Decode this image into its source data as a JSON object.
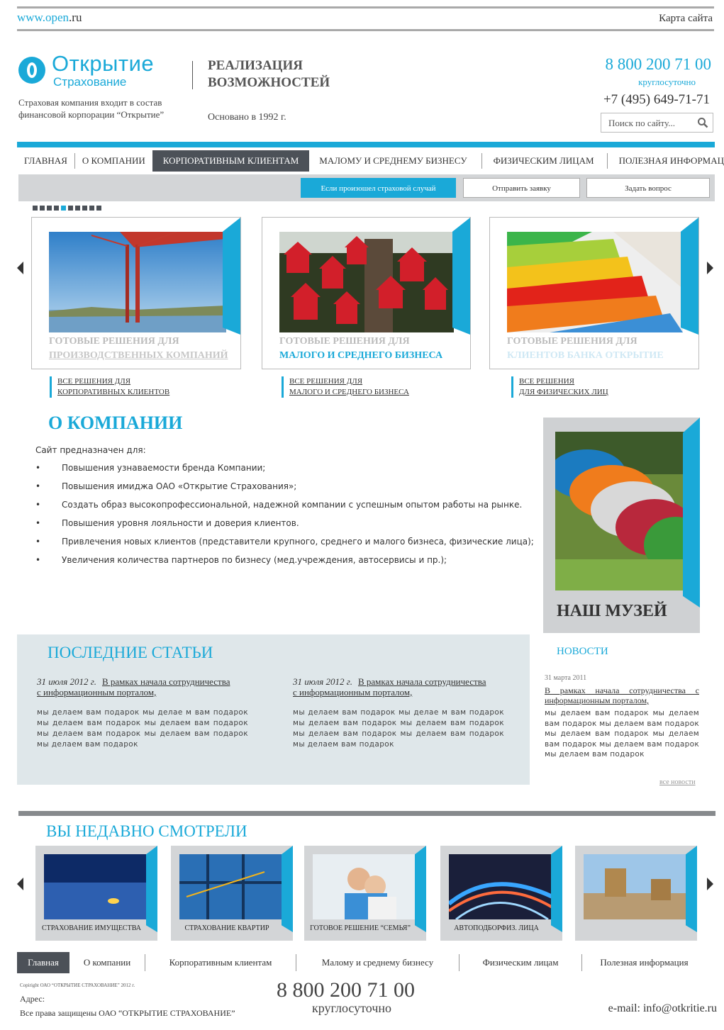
{
  "header": {
    "site_url_prefix": "www.open",
    "site_url_suffix": ".ru",
    "sitemap_label": "Карта сайта",
    "logo_title": "Открытие",
    "logo_subtitle": "Страхование",
    "company_desc": "Страховая компания входит в состав финансовой корпорации “Открытие”",
    "slogan_line1": "РЕАЛИЗАЦИЯ",
    "slogan_line2": "ВОЗМОЖНОСТЕЙ",
    "founded": "Основано в 1992 г.",
    "phone_main": "8 800 200 71 00",
    "phone_main_note": "круглосуточно",
    "phone_moscow": "+7 (495) 649-71-71",
    "search_placeholder": "Поиск по сайту...",
    "search_icon": "magnifier-icon"
  },
  "nav": {
    "items": [
      "ГЛАВНАЯ",
      "О КОМПАНИИ",
      "КОРПОРАТИВНЫМ КЛИЕНТАМ",
      "МАЛОМУ И СРЕДНЕМУ БИЗНЕСУ",
      "ФИЗИЧЕСКИМ ЛИЦАМ",
      "ПОЛЕЗНАЯ ИНФОРМАЦИЯ"
    ],
    "active": "КОРПОРАТИВНЫМ КЛИЕНТАМ"
  },
  "actions": {
    "insured_event": "Если произошел страховой случай",
    "send_request": "Отправить заявку",
    "ask_question": "Задать вопрос"
  },
  "slider": {
    "dot_count": 10,
    "active_dot": 5,
    "cards": [
      {
        "title_line1": "ГОТОВЫЕ РЕШЕНИЯ ДЛЯ",
        "title_line2": "ПРОИЗВОДСТВЕННЫХ КОМПАНИЙ",
        "link_line1": "ВСЕ РЕШЕНИЯ ДЛЯ",
        "link_line2": "КОРПОРАТИВНЫХ КЛИЕНТОВ",
        "image": "bridge"
      },
      {
        "title_line1": "ГОТОВЫЕ РЕШЕНИЯ ДЛЯ",
        "title_line2": "МАЛОГО И СРЕДНЕГО БИЗНЕСА",
        "link_line1": "ВСЕ РЕШЕНИЯ ДЛЯ",
        "link_line2": "МАЛОГО И СРЕДНЕГО БИЗНЕСА",
        "image": "birdhouses"
      },
      {
        "title_line1": "ГОТОВЫЕ РЕШЕНИЯ ДЛЯ",
        "title_line2": "КЛИЕНТОВ БАНКА ОТКРЫТИЕ",
        "link_line1": "ВСЕ РЕШЕНИЯ",
        "link_line2": "ДЛЯ ФИЗИЧЕСКИХ ЛИЦ",
        "image": "colored-stairs"
      }
    ]
  },
  "about": {
    "title": "О КОМПАНИИ",
    "intro": "Сайт предназначен для:",
    "items": [
      "Повышения узнаваемости бренда Компании;",
      "Повышения имиджа ОАО «Открытие Страхования»;",
      "Создать образ высокопрофессиональной, надежной компании с успешным опытом работы на рынке.",
      "Повышения уровня лояльности и доверия клиентов.",
      "Привлечения новых клиентов (представители крупного, среднего и малого бизнеса, физические лица);",
      "Увеличения количества партнеров по бизнесу (мед.учреждения, автосервисы и пр.);"
    ]
  },
  "museum": {
    "label": "НАШ МУЗЕЙ",
    "image": "vintage-cars"
  },
  "articles": {
    "title": "ПОСЛЕДНИЕ СТАТЬИ",
    "items": [
      {
        "date": "31 июля 2012 г.",
        "headline_1": "В рамках начала сотрудничества",
        "headline_2": "с информационным порталом,",
        "body": "мы делаем вам подарок мы делае м вам подарок мы делаем вам подарок мы делаем вам подарок мы делаем вам подарок мы делаем вам подарок мы делаем вам подарок"
      },
      {
        "date": "31 июля 2012 г.",
        "headline_1": "В рамках начала сотрудничества",
        "headline_2": "с информационным порталом,",
        "body": "мы делаем вам подарок мы делае м вам подарок мы делаем вам подарок мы делаем вам подарок мы делаем вам подарок мы делаем вам подарок мы делаем вам подарок"
      }
    ]
  },
  "news": {
    "title": "НОВОСТИ",
    "date": "31 марта 2011",
    "headline": "В рамках начала сотрудничества с информационным порталом,",
    "body": "мы делаем вам подарок мы делаем вам подарок мы делаем вам подарок мы делаем вам подарок мы делаем вам подарок мы делаем вам подарок мы делаем вам подарок",
    "all_link": "все новости"
  },
  "recent": {
    "title": "ВЫ НЕДАВНО СМОТРЕЛИ",
    "items": [
      {
        "label": "СТРАХОВАНИЕ ИМУЩЕСТВА",
        "image": "night-house"
      },
      {
        "label": "СТРАХОВАНИЕ КВАРТИР",
        "image": "construction-glass"
      },
      {
        "label": "ГОТОВОЕ РЕШЕНИЕ “СЕМЬЯ”",
        "image": "couple"
      },
      {
        "label": "АВТОПОДБОРФИЗ. ЛИЦА",
        "image": "highway-lights"
      },
      {
        "label": "",
        "image": "boxes"
      }
    ]
  },
  "footer": {
    "nav": [
      "Главная",
      "О компании",
      "Корпоративным клиентам",
      "Малому и среднему бизнесу",
      "Физическим лицам",
      "Полезная информация"
    ],
    "active": "Главная",
    "copyright": "Copiright ОАО “ОТКРЫТИЕ СТРАХОВАНИЕ” 2012 г.",
    "address_label": "Адрес:",
    "rights": "Все права защищены ОАО “ОТКРЫТИЕ СТРАХОВАНИЕ”",
    "phone": "8 800 200 71 00",
    "phone_note": "круглосуточно",
    "email": "e-mail: info@otkritie.ru"
  },
  "colors": {
    "accent": "#1aa9d8",
    "dark": "#4c5158",
    "panel": "#dfe7ea"
  }
}
